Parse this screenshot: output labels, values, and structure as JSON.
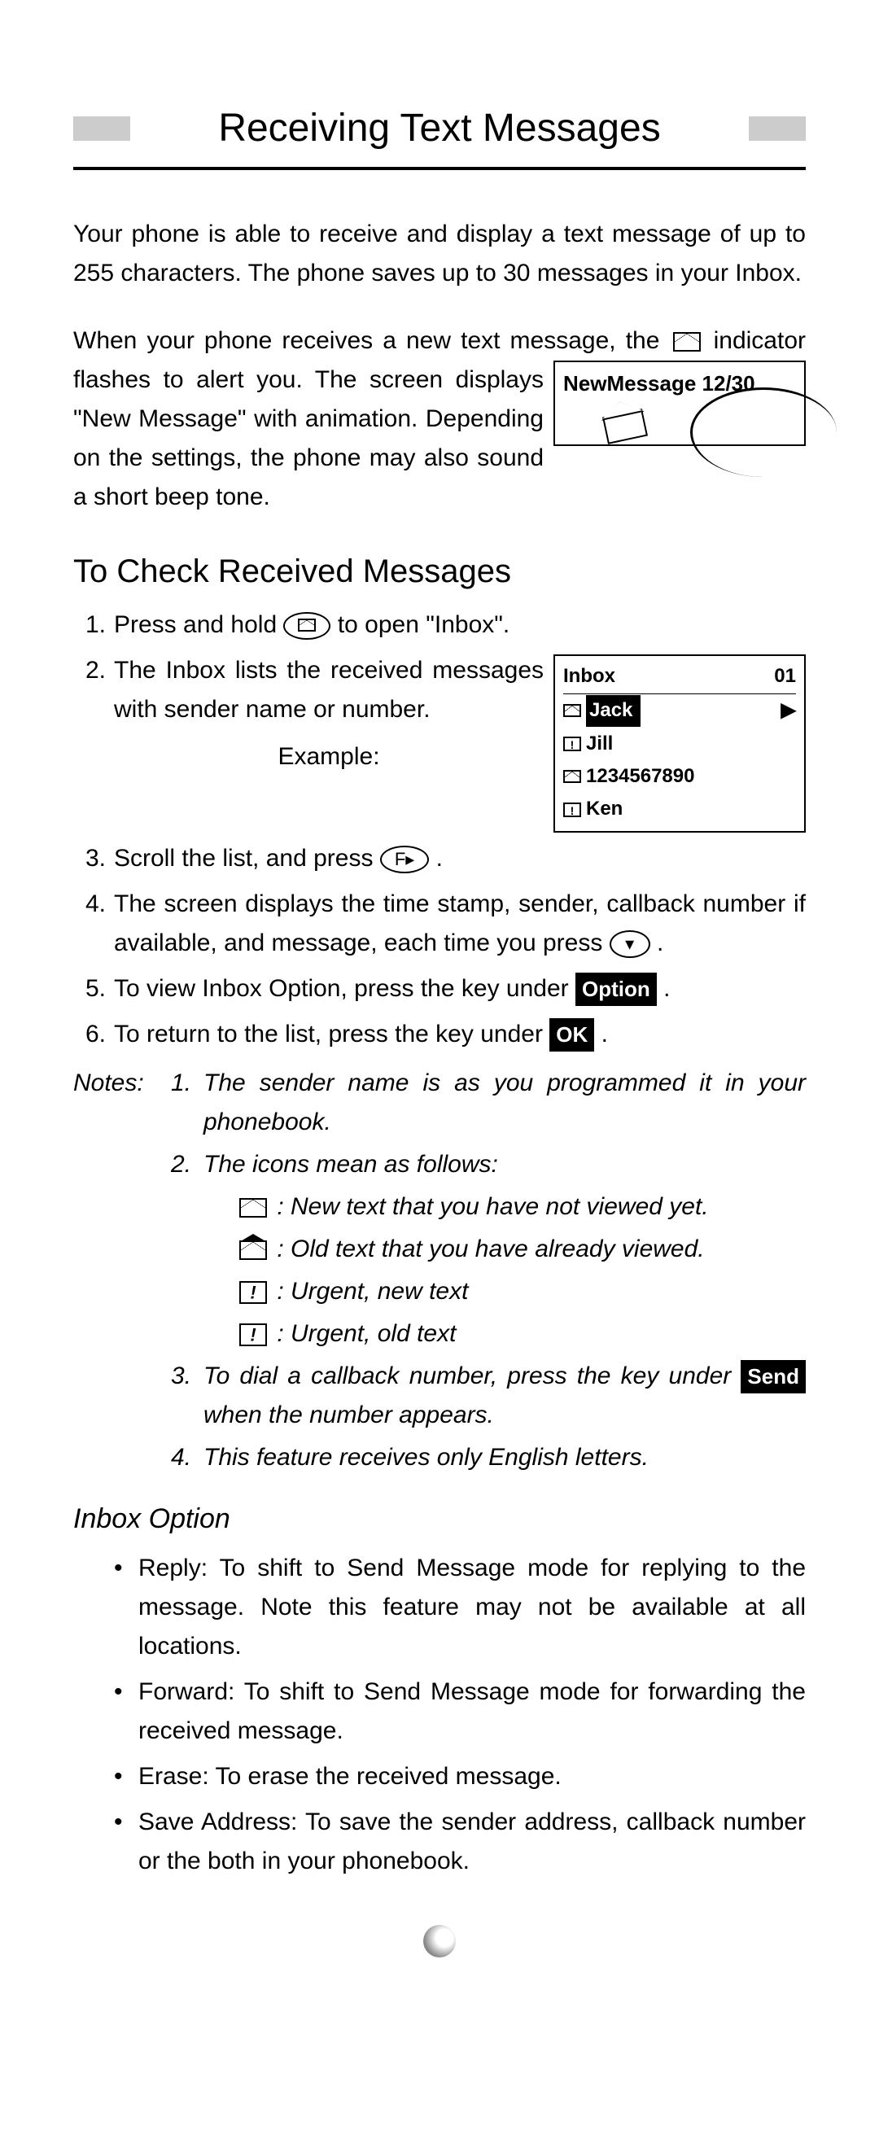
{
  "title": "Receiving Text Messages",
  "intro": "Your phone is able to receive and display a text message of up to 255 characters. The phone saves up to 30 messages in your Inbox.",
  "intro2_a": "When your phone receives a new text message, the ",
  "intro2_b": " indicator flashes to alert you. The screen displays \"New Message\" with animation. Depending on the settings, the phone may also sound a short beep tone.",
  "newmsg_screen": "NewMessage 12/30",
  "section_check": "To Check Received Messages",
  "steps": {
    "s1a": "Press and hold ",
    "s1b": " to open \"Inbox\".",
    "s2": "The Inbox lists the received messages with sender name or number.",
    "example": "Example:",
    "s3a": "Scroll the list, and press ",
    "s3b": ".",
    "s4a": "The screen displays the time stamp, sender, callback number if available, and message, each time you press ",
    "s4b": ".",
    "s5a": "To view Inbox Option, press the key under ",
    "s5b": ".",
    "s6a": "To return to the list, press the key under ",
    "s6b": "."
  },
  "key_option": "Option",
  "key_ok": "OK",
  "key_send": "Send",
  "inbox_screen": {
    "title": "Inbox",
    "count": "01",
    "items": [
      "Jack",
      "Jill",
      "1234567890",
      "Ken"
    ]
  },
  "notes_label": "Notes:",
  "notes": {
    "n1": "The sender name is as you programmed it in your phonebook.",
    "n2": "The icons mean as follows:",
    "icon1": ": New text that you have not viewed yet.",
    "icon2": ": Old text that you have already viewed.",
    "icon3": ": Urgent, new text",
    "icon4": ": Urgent, old text",
    "n3a": "To dial a callback number, press the key under ",
    "n3b": " when the number appears.",
    "n4": "This feature receives only English letters."
  },
  "inbox_option_title": "Inbox Option",
  "options": {
    "reply_label": "Reply:",
    "reply": "To shift to Send Message mode for replying to the message. Note this feature may not be available at all locations.",
    "forward_label": "Forward:",
    "forward": "To shift to Send Message mode for forwarding the received message.",
    "erase_label": "Erase:",
    "erase": "To erase the received message.",
    "save_label": "Save Address:",
    "save": "To save the sender address, callback number or the both in your phonebook."
  }
}
